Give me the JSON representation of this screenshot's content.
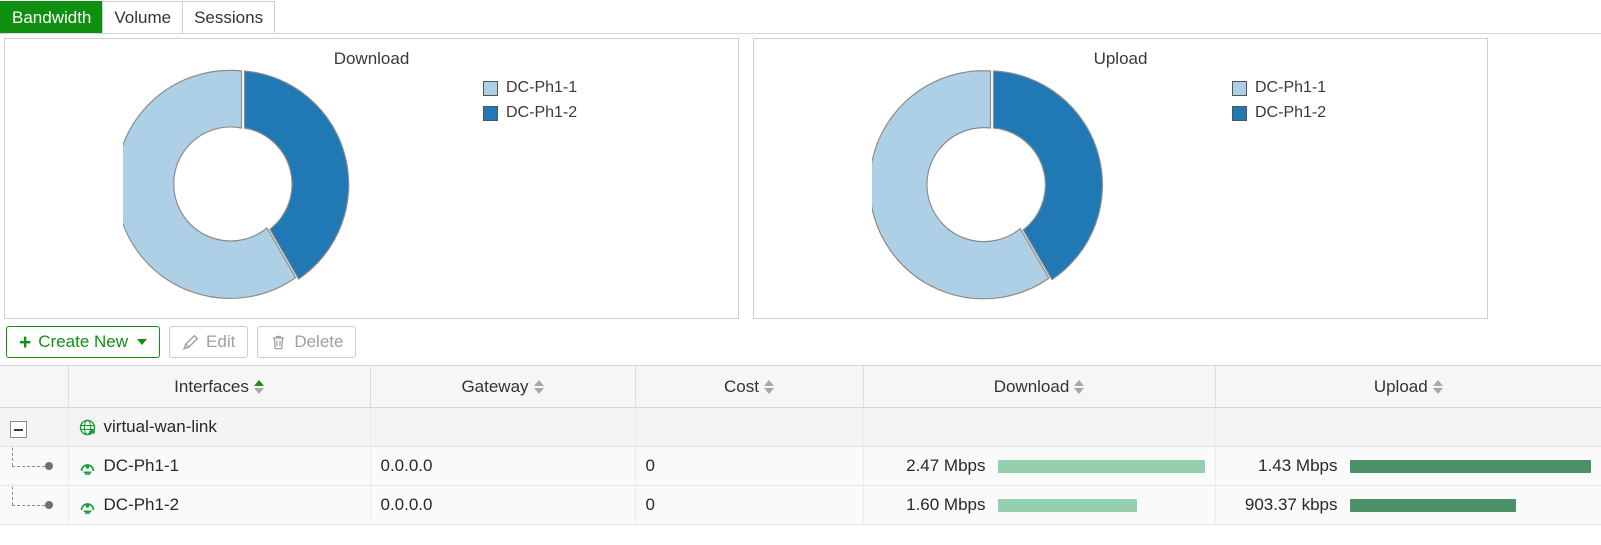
{
  "tabs": [
    {
      "label": "Bandwidth",
      "active": true
    },
    {
      "label": "Volume",
      "active": false
    },
    {
      "label": "Sessions",
      "active": false
    }
  ],
  "charts": [
    {
      "title": "Download",
      "legend": [
        {
          "label": "DC-Ph1-1",
          "color": "#aed0e6"
        },
        {
          "label": "DC-Ph1-2",
          "color": "#2079b5"
        }
      ]
    },
    {
      "title": "Upload",
      "legend": [
        {
          "label": "DC-Ph1-1",
          "color": "#aed0e6"
        },
        {
          "label": "DC-Ph1-2",
          "color": "#2079b5"
        }
      ]
    }
  ],
  "chart_data": [
    {
      "type": "pie",
      "title": "Download",
      "donut": true,
      "categories": [
        "DC-Ph1-1",
        "DC-Ph1-2"
      ],
      "values": [
        2.47,
        1.6
      ],
      "unit": "Mbps",
      "percentages": [
        60.7,
        39.3
      ],
      "colors": [
        "#aed0e6",
        "#2079b5"
      ],
      "legend_position": "right",
      "start_angle_deg": 0,
      "direction": "clockwise"
    },
    {
      "type": "pie",
      "title": "Upload",
      "donut": true,
      "categories": [
        "DC-Ph1-1",
        "DC-Ph1-2"
      ],
      "values": [
        1430,
        903.37
      ],
      "unit": "kbps",
      "percentages": [
        61.3,
        38.7
      ],
      "colors": [
        "#aed0e6",
        "#2079b5"
      ],
      "legend_position": "right",
      "start_angle_deg": 0,
      "direction": "clockwise"
    }
  ],
  "toolbar": {
    "create_label": "Create New",
    "edit_label": "Edit",
    "delete_label": "Delete"
  },
  "table": {
    "columns": [
      {
        "label": "",
        "sortable": false,
        "sorted": false
      },
      {
        "label": "Interfaces",
        "sortable": true,
        "sorted": true
      },
      {
        "label": "Gateway",
        "sortable": true,
        "sorted": false
      },
      {
        "label": "Cost",
        "sortable": true,
        "sorted": false
      },
      {
        "label": "Download",
        "sortable": true,
        "sorted": false
      },
      {
        "label": "Upload",
        "sortable": true,
        "sorted": false
      }
    ],
    "rows": [
      {
        "type": "parent",
        "name": "virtual-wan-link",
        "gateway": "",
        "cost": "",
        "download": "",
        "upload": "",
        "download_bar_pct": 0,
        "upload_bar_pct": 0
      },
      {
        "type": "child",
        "name": "DC-Ph1-1",
        "gateway": "0.0.0.0",
        "cost": "0",
        "download": "2.47 Mbps",
        "upload": "1.43 Mbps",
        "download_bar_pct": 100,
        "upload_bar_pct": 100
      },
      {
        "type": "child",
        "name": "DC-Ph1-2",
        "gateway": "0.0.0.0",
        "cost": "0",
        "download": "1.60 Mbps",
        "upload": "903.37 kbps",
        "download_bar_pct": 65,
        "upload_bar_pct": 63
      }
    ]
  },
  "colors": {
    "accent_green": "#109010",
    "pie_light": "#aed0e6",
    "pie_dark": "#2079b5",
    "bar_download": "#95cfae",
    "bar_upload": "#4a9169"
  }
}
